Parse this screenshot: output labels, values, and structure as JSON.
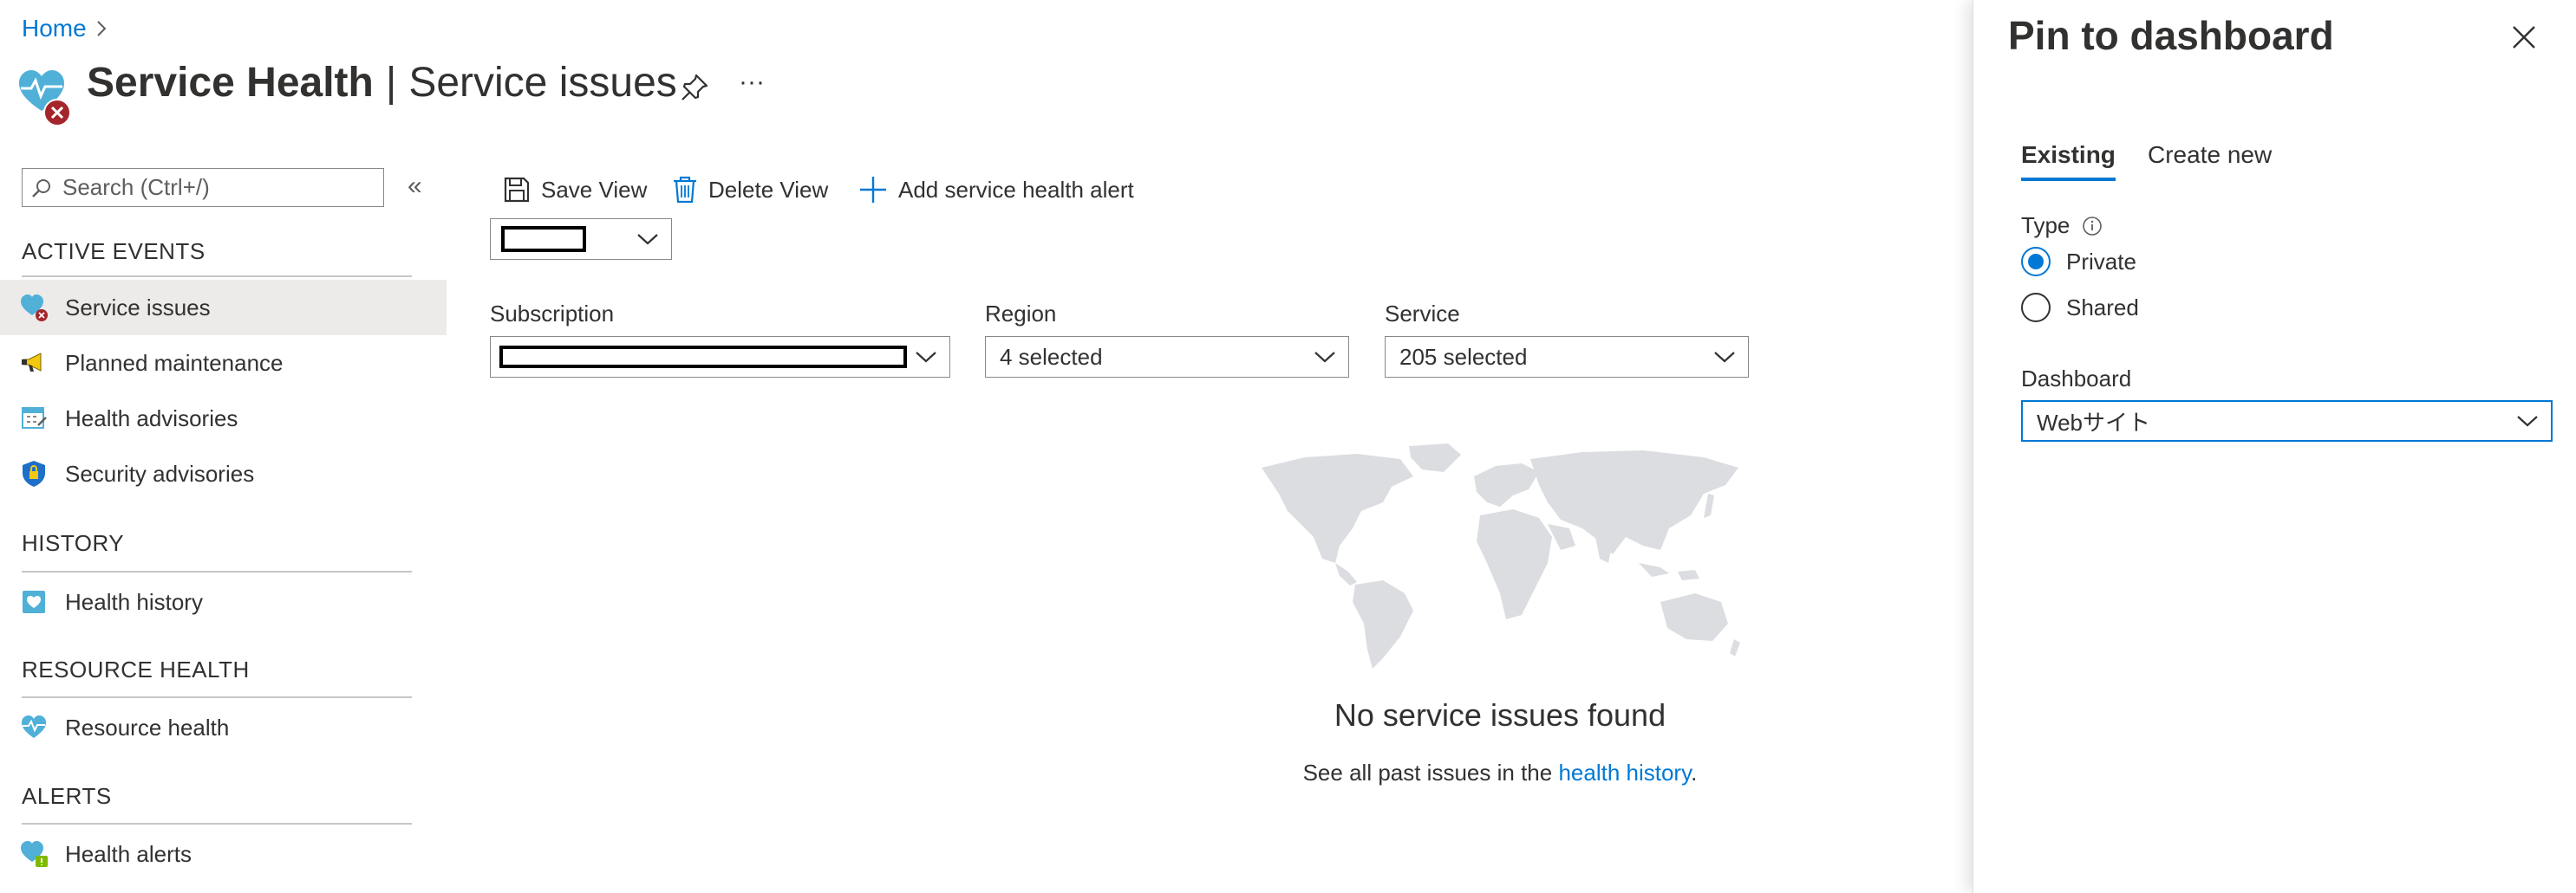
{
  "breadcrumb": {
    "home": "Home"
  },
  "header": {
    "title_main": "Service Health",
    "title_separator": "|",
    "title_sub": "Service issues",
    "more": "···"
  },
  "sidebar": {
    "search_placeholder": "Search (Ctrl+/)",
    "collapse": "«",
    "sections": {
      "active_events": "ACTIVE EVENTS",
      "history": "HISTORY",
      "resource_health": "RESOURCE HEALTH",
      "alerts": "ALERTS"
    },
    "items": {
      "service_issues": "Service issues",
      "planned_maintenance": "Planned maintenance",
      "health_advisories": "Health advisories",
      "security_advisories": "Security advisories",
      "health_history": "Health history",
      "resource_health": "Resource health",
      "health_alerts": "Health alerts"
    }
  },
  "toolbar": {
    "save_view": "Save View",
    "delete_view": "Delete View",
    "add_alert": "Add service health alert"
  },
  "filters": {
    "subscription_label": "Subscription",
    "region_label": "Region",
    "region_value": "4 selected",
    "service_label": "Service",
    "service_value": "205 selected"
  },
  "empty_state": {
    "title": "No service issues found",
    "subtitle_prefix": "See all past issues in the ",
    "link": "health history",
    "subtitle_suffix": "."
  },
  "pin_panel": {
    "title": "Pin to dashboard",
    "tabs": {
      "existing": "Existing",
      "create_new": "Create new"
    },
    "type_label": "Type",
    "options": {
      "private": "Private",
      "shared": "Shared"
    },
    "dashboard_label": "Dashboard",
    "dashboard_value": "Webサイト"
  },
  "colors": {
    "accent": "#0078d4",
    "error": "#a4262c",
    "text": "#323130",
    "map": "#e1e1e4"
  }
}
